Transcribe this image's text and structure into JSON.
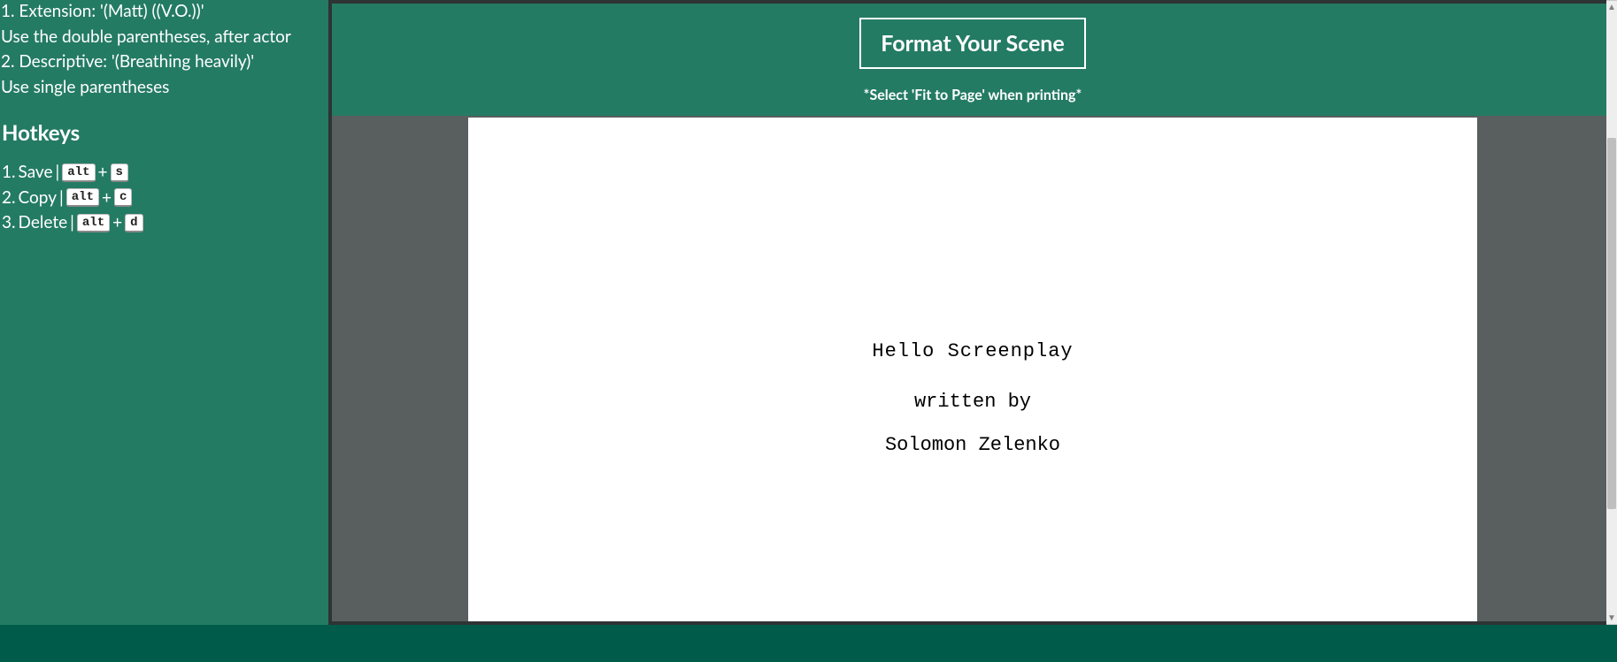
{
  "sidebar": {
    "line_extension_prefix": "1. Extension: '(Matt) ((V.O.))'",
    "line_extension_desc": "Use the double parentheses, after actor",
    "line_descriptive_prefix": "2. Descriptive: '(Breathing heavily)'",
    "line_descriptive_desc": "Use single parentheses",
    "hotkeys_heading": "Hotkeys",
    "hotkeys": [
      {
        "idx": "1.",
        "label": "Save",
        "mod": "alt",
        "plus": "+",
        "key": "s"
      },
      {
        "idx": "2.",
        "label": "Copy",
        "mod": "alt",
        "plus": "+",
        "key": "c"
      },
      {
        "idx": "3.",
        "label": "Delete",
        "mod": "alt",
        "plus": "+",
        "key": "d"
      }
    ],
    "pipe": " | "
  },
  "toolbar": {
    "format_label": "Format Your Scene",
    "print_note": "*Select 'Fit to Page' when printing*"
  },
  "page": {
    "title": "Hello Screenplay",
    "by": "written by",
    "author": "Solomon Zelenko"
  },
  "scrollbar": {
    "up": "▲",
    "down": "▼"
  }
}
